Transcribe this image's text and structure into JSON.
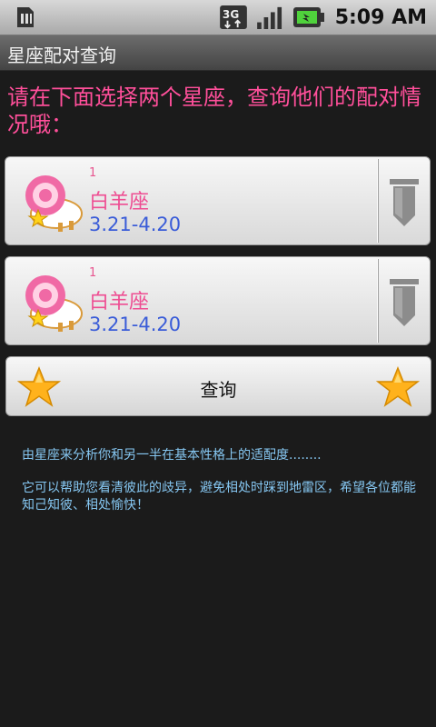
{
  "status_bar": {
    "time": "5:09 AM",
    "network_label": "3G",
    "icons": [
      "sim-card-icon",
      "network-3g-icon",
      "signal-icon",
      "battery-icon"
    ]
  },
  "title_bar": {
    "title": "星座配对查询"
  },
  "instruction": "请在下面选择两个星座，查询他们的配对情况哦：",
  "spinners": [
    {
      "index": "1",
      "name": "白羊座",
      "dates": "3.21-4.20",
      "icon": "aries-sheep-icon"
    },
    {
      "index": "1",
      "name": "白羊座",
      "dates": "3.21-4.20",
      "icon": "aries-sheep-icon"
    }
  ],
  "query_button": {
    "label": "查询",
    "icon": "star-icon"
  },
  "descriptions": [
    "由星座来分析你和另一半在基本性格上的适配度........",
    "它可以帮助您看清彼此的歧异，避免相处时踩到地雷区，希望各位都能知己知彼、相处愉快！"
  ],
  "colors": {
    "instruction": "#ff4f9a",
    "sign_name": "#ee4d92",
    "sign_dates": "#3a5cd8",
    "description": "#86c7f2",
    "background": "#1b1b1b"
  }
}
